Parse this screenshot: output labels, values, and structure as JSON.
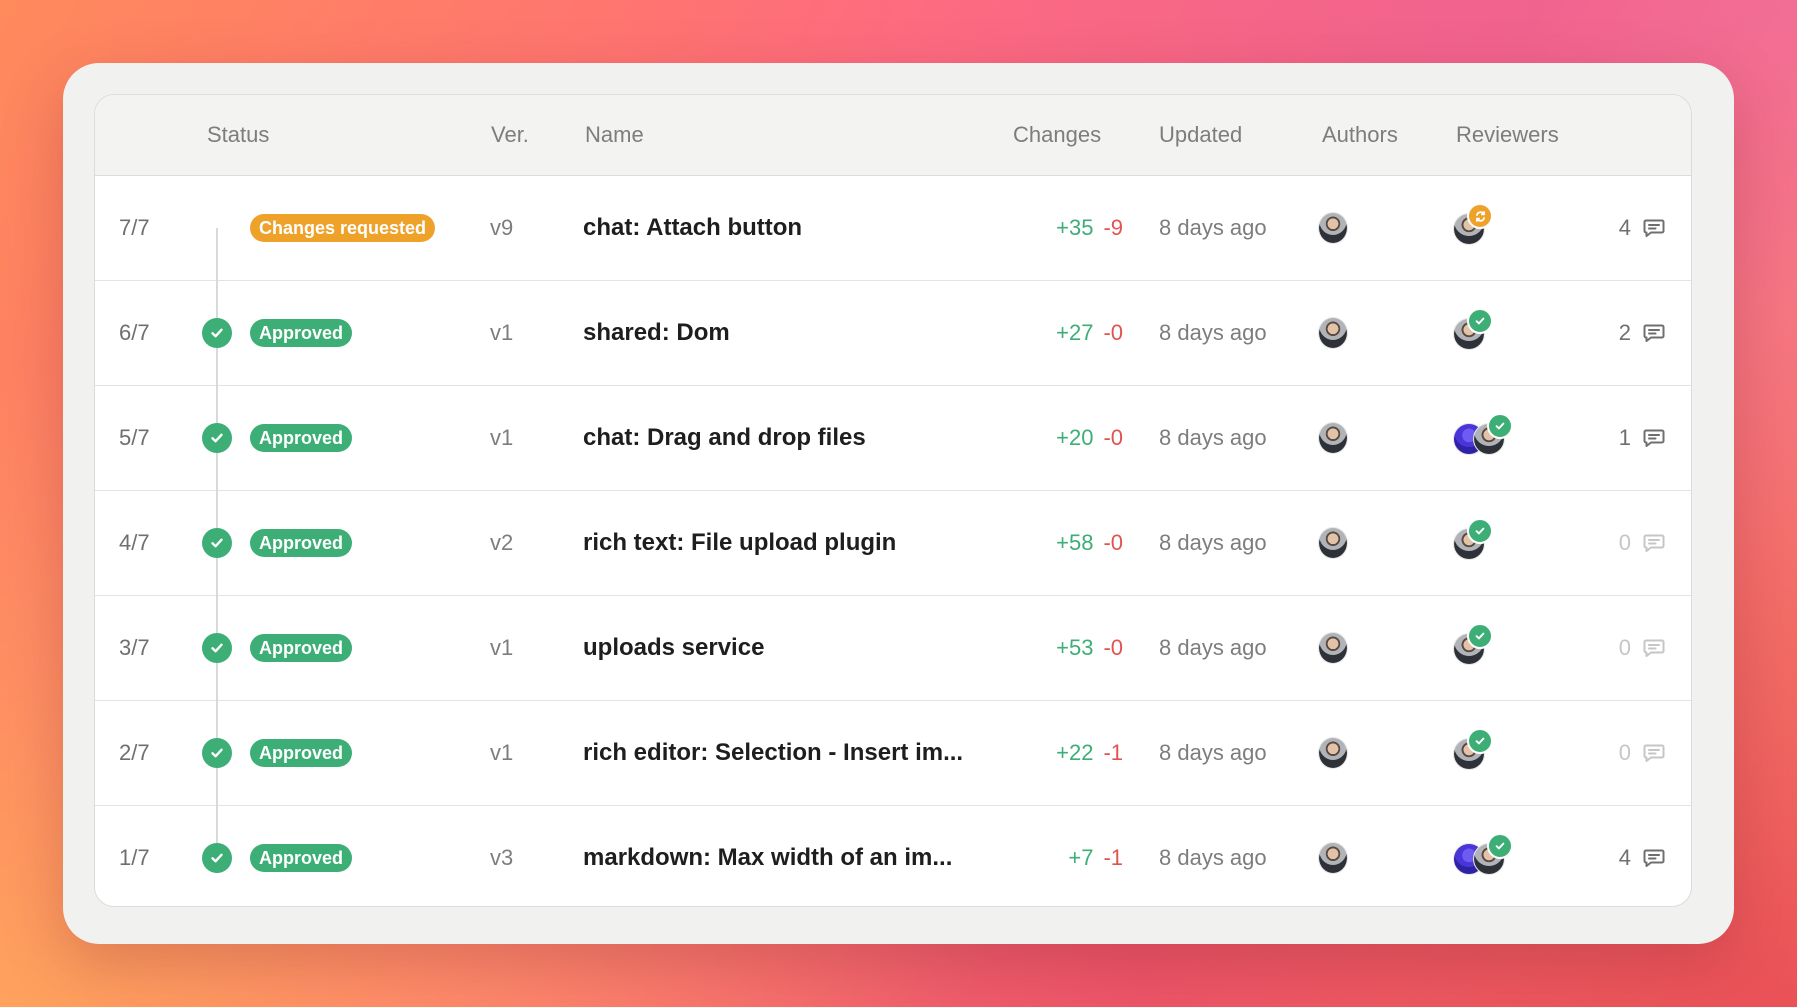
{
  "columns": {
    "status": "Status",
    "ver": "Ver.",
    "name": "Name",
    "changes": "Changes",
    "updated": "Updated",
    "authors": "Authors",
    "reviewers": "Reviewers"
  },
  "rows": [
    {
      "index": "7/7",
      "status": "Changes requested",
      "status_type": "changes-requested",
      "version": "v9",
      "name": "chat: Attach button",
      "additions": "+35",
      "deletions": "-9",
      "updated": "8 days ago",
      "author_avatar": "user-avatar",
      "reviewers": [
        "user-avatar"
      ],
      "reviewer_status": "changes-requested-icon",
      "comments": "4"
    },
    {
      "index": "6/7",
      "status": "Approved",
      "status_type": "approved",
      "version": "v1",
      "name": "shared: Dom",
      "additions": "+27",
      "deletions": "-0",
      "updated": "8 days ago",
      "author_avatar": "user-avatar",
      "reviewers": [
        "user-avatar"
      ],
      "reviewer_status": "check-icon",
      "comments": "2"
    },
    {
      "index": "5/7",
      "status": "Approved",
      "status_type": "approved",
      "version": "v1",
      "name": "chat: Drag and drop files",
      "additions": "+20",
      "deletions": "-0",
      "updated": "8 days ago",
      "author_avatar": "user-avatar",
      "reviewers": [
        "purple-avatar",
        "user-avatar"
      ],
      "reviewer_status": "check-icon",
      "comments": "1"
    },
    {
      "index": "4/7",
      "status": "Approved",
      "status_type": "approved",
      "version": "v2",
      "name": "rich text: File upload plugin",
      "additions": "+58",
      "deletions": "-0",
      "updated": "8 days ago",
      "author_avatar": "user-avatar",
      "reviewers": [
        "user-avatar"
      ],
      "reviewer_status": "check-icon",
      "comments": "0"
    },
    {
      "index": "3/7",
      "status": "Approved",
      "status_type": "approved",
      "version": "v1",
      "name": "uploads service",
      "additions": "+53",
      "deletions": "-0",
      "updated": "8 days ago",
      "author_avatar": "user-avatar",
      "reviewers": [
        "user-avatar"
      ],
      "reviewer_status": "check-icon",
      "comments": "0"
    },
    {
      "index": "2/7",
      "status": "Approved",
      "status_type": "approved",
      "version": "v1",
      "name": "rich editor: Selection - Insert im...",
      "additions": "+22",
      "deletions": "-1",
      "updated": "8 days ago",
      "author_avatar": "user-avatar",
      "reviewers": [
        "user-avatar"
      ],
      "reviewer_status": "check-icon",
      "comments": "0"
    },
    {
      "index": "1/7",
      "status": "Approved",
      "status_type": "approved",
      "version": "v3",
      "name": "markdown: Max width of an im...",
      "additions": "+7",
      "deletions": "-1",
      "updated": "8 days ago",
      "author_avatar": "user-avatar",
      "reviewers": [
        "purple-avatar",
        "user-avatar"
      ],
      "reviewer_status": "check-icon",
      "comments": "4"
    }
  ],
  "colors": {
    "approved": "#3cae76",
    "changes_requested": "#eea22a",
    "additions": "#3cae76",
    "deletions": "#e0534f"
  }
}
